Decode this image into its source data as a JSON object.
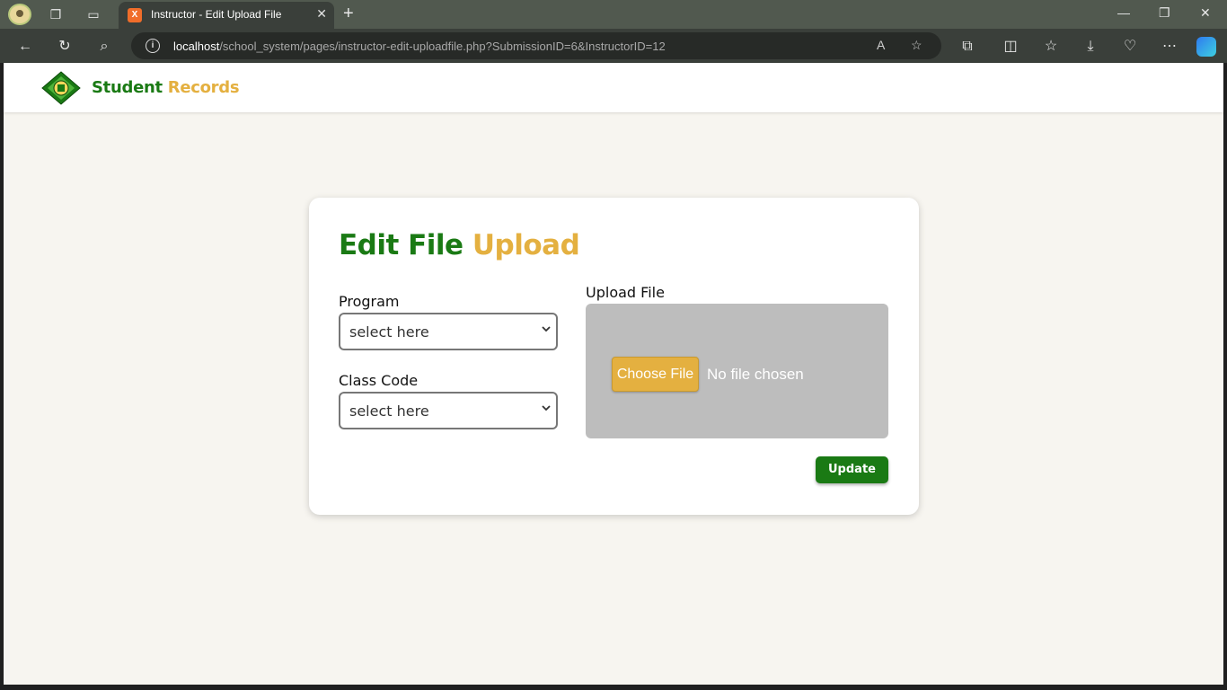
{
  "browser": {
    "tab_title": "Instructor - Edit Upload File",
    "tab_favicon_glyph": "X",
    "url_host": "localhost",
    "url_path": "/school_system/pages/instructor-edit-uploadfile.php?SubmissionID=6&InstructorID=12",
    "icons": [
      "workspaces-icon",
      "tab-actions-icon",
      "new-tab-icon",
      "back-icon",
      "refresh-icon",
      "search-icon",
      "read-aloud-icon",
      "favorite-icon",
      "extensions-icon",
      "split-screen-icon",
      "favorites-icon",
      "downloads-icon",
      "browser-essentials-icon",
      "more-icon",
      "copilot-icon",
      "minimize-icon",
      "restore-icon",
      "close-icon"
    ]
  },
  "header": {
    "brand_part1": "Student",
    "brand_part2": "Records"
  },
  "form": {
    "title_part1": "Edit File",
    "title_part2": "Upload",
    "program_label": "Program",
    "program_value": "select here",
    "class_code_label": "Class Code",
    "class_code_value": "select here",
    "upload_label": "Upload File",
    "choose_file_label": "Choose File",
    "no_file_text": "No file chosen",
    "update_label": "Update"
  },
  "colors": {
    "brand_green": "#1a7a14",
    "brand_gold": "#e4b040",
    "page_bg": "#f7f5f0",
    "upload_bg": "#bdbdbd"
  }
}
